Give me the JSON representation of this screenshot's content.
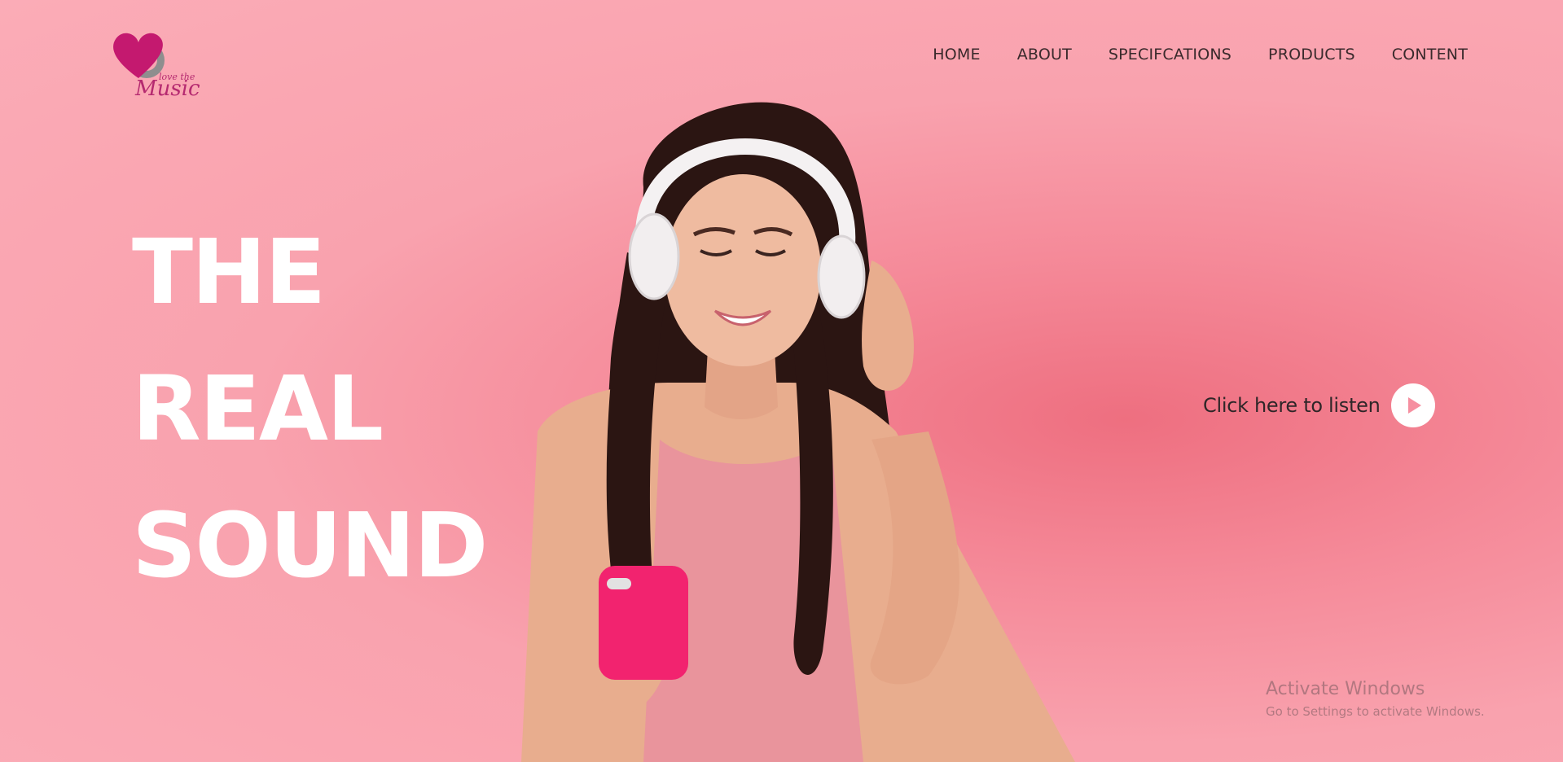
{
  "brand": {
    "logo_small": "love the",
    "logo_big": "Music",
    "heart_color": "#c4196f"
  },
  "nav": {
    "items": [
      {
        "label": "HOME"
      },
      {
        "label": "ABOUT"
      },
      {
        "label": "SPECIFCATIONS"
      },
      {
        "label": "PRODUCTS"
      },
      {
        "label": "CONTENT"
      }
    ]
  },
  "hero": {
    "lines": [
      "THE",
      "REAL",
      "SOUND"
    ]
  },
  "cta": {
    "label": "Click here to listen",
    "icon": "play-icon"
  },
  "watermark": {
    "title": "Activate Windows",
    "subtitle": "Go to Settings to activate Windows."
  },
  "colors": {
    "background": "#f9a2ae",
    "hero_text": "#ffffff",
    "phone": "#f2236f"
  }
}
